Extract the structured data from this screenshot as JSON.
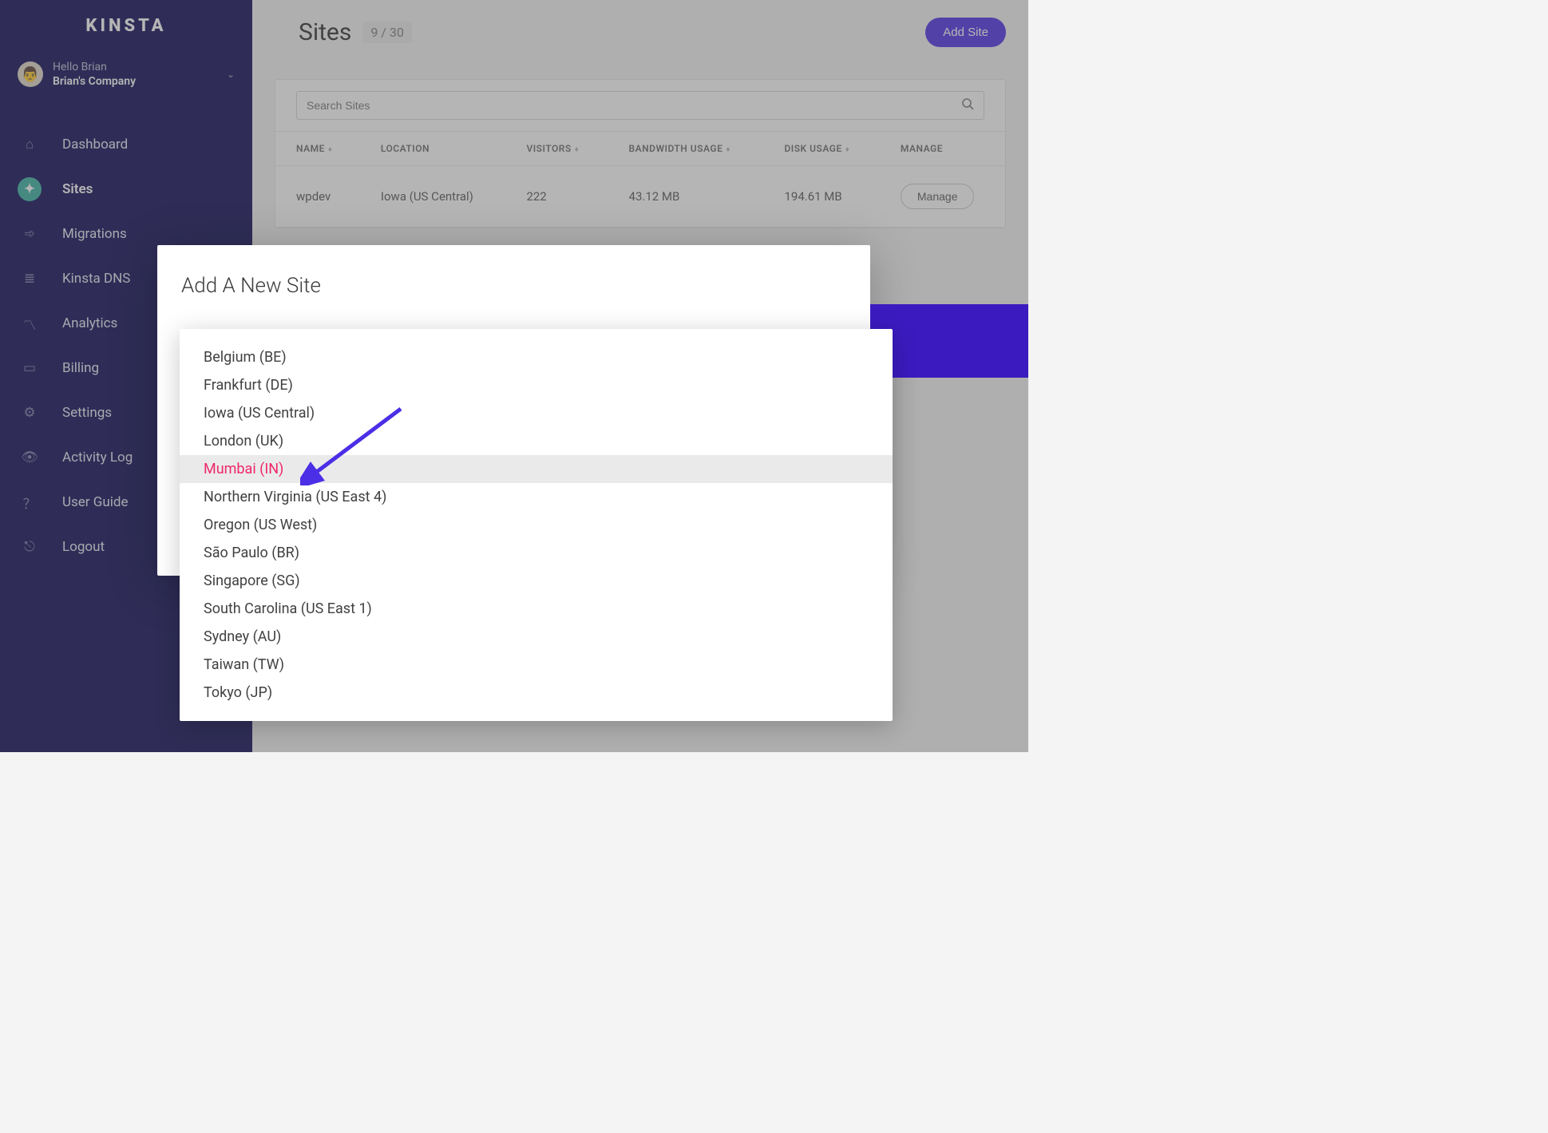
{
  "brand": "KINSTA",
  "user": {
    "hello": "Hello Brian",
    "company": "Brian's Company"
  },
  "nav": {
    "dashboard": "Dashboard",
    "sites": "Sites",
    "migrations": "Migrations",
    "kinsta_dns": "Kinsta DNS",
    "analytics": "Analytics",
    "billing": "Billing",
    "settings": "Settings",
    "activity_log": "Activity Log",
    "user_guide": "User Guide",
    "logout": "Logout"
  },
  "header": {
    "title": "Sites",
    "count": "9 / 30",
    "add_site": "Add Site"
  },
  "search": {
    "placeholder": "Search Sites"
  },
  "columns": {
    "name": "NAME",
    "location": "LOCATION",
    "visitors": "VISITORS",
    "bandwidth": "BANDWIDTH USAGE",
    "disk": "DISK USAGE",
    "manage": "MANAGE"
  },
  "rows": [
    {
      "name": "wpdev",
      "location": "Iowa (US Central)",
      "visitors": "222",
      "bandwidth": "43.12 MB",
      "disk": "194.61 MB",
      "manage": "Manage"
    }
  ],
  "modal": {
    "title": "Add A New Site"
  },
  "locations": [
    "Belgium (BE)",
    "Frankfurt (DE)",
    "Iowa (US Central)",
    "London (UK)",
    "Mumbai (IN)",
    "Northern Virginia (US East 4)",
    "Oregon (US West)",
    "São Paulo (BR)",
    "Singapore (SG)",
    "South Carolina (US East 1)",
    "Sydney (AU)",
    "Taiwan (TW)",
    "Tokyo (JP)"
  ],
  "highlighted_location_index": 4
}
